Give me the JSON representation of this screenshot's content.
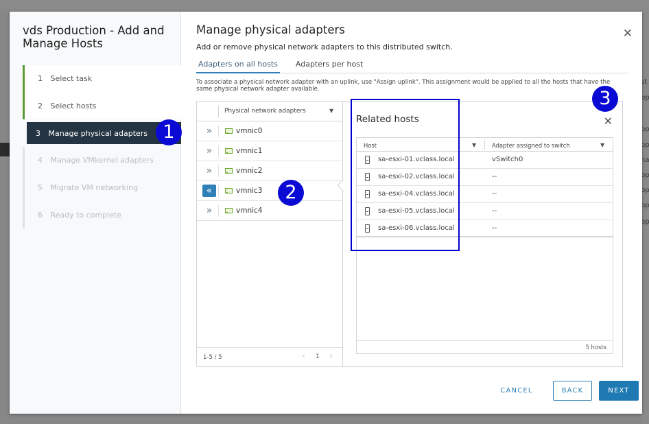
{
  "background": {
    "right_snippets": [
      "st",
      "pp",
      "pp",
      "pp",
      "ha",
      "pp",
      "pp",
      "pp",
      "pp"
    ]
  },
  "wizard": {
    "title": "vds Production - Add and Manage Hosts",
    "steps": [
      {
        "num": "1",
        "label": "Select task",
        "state": "done"
      },
      {
        "num": "2",
        "label": "Select hosts",
        "state": "done"
      },
      {
        "num": "3",
        "label": "Manage physical adapters",
        "state": "active"
      },
      {
        "num": "4",
        "label": "Manage VMkernel adapters",
        "state": "disabled"
      },
      {
        "num": "5",
        "label": "Migrate VM networking",
        "state": "disabled"
      },
      {
        "num": "6",
        "label": "Ready to complete",
        "state": "disabled"
      }
    ]
  },
  "main": {
    "title": "Manage physical adapters",
    "close_icon": "close-icon",
    "subtitle": "Add or remove physical network adapters to this distributed switch.",
    "tabs": [
      {
        "label": "Adapters on all hosts",
        "active": true
      },
      {
        "label": "Adapters per host",
        "active": false
      }
    ],
    "info": "To associate a physical network adapter with an uplink, use \"Assign uplink\". This assignment would be applied to all the hosts that have the same physical network adapter available."
  },
  "adapters": {
    "column_header": "Physical network adapters",
    "items": [
      {
        "name": "vmnic0",
        "selected": false
      },
      {
        "name": "vmnic1",
        "selected": false
      },
      {
        "name": "vmnic2",
        "selected": false
      },
      {
        "name": "vmnic3",
        "selected": true
      },
      {
        "name": "vmnic4",
        "selected": false
      }
    ],
    "pagination": {
      "range": "1-5 / 5",
      "page": "1"
    }
  },
  "related_hosts": {
    "title": "Related hosts",
    "columns": [
      "Host",
      "Adapter assigned to switch"
    ],
    "rows": [
      {
        "host": "sa-esxi-01.vclass.local",
        "switch": "vSwitch0"
      },
      {
        "host": "sa-esxi-02.vclass.local",
        "switch": "--"
      },
      {
        "host": "sa-esxi-04.vclass.local",
        "switch": "--"
      },
      {
        "host": "sa-esxi-05.vclass.local",
        "switch": "--"
      },
      {
        "host": "sa-esxi-06.vclass.local",
        "switch": "--"
      }
    ],
    "footer": "5 hosts"
  },
  "annotations": [
    "1",
    "2",
    "3"
  ],
  "buttons": {
    "cancel": "CANCEL",
    "back": "BACK",
    "next": "NEXT"
  },
  "colors": {
    "accent": "#2f80b6",
    "active_step_bg": "#253443",
    "done_step": "#5c9a31",
    "annotation": "#0a0ad4"
  }
}
